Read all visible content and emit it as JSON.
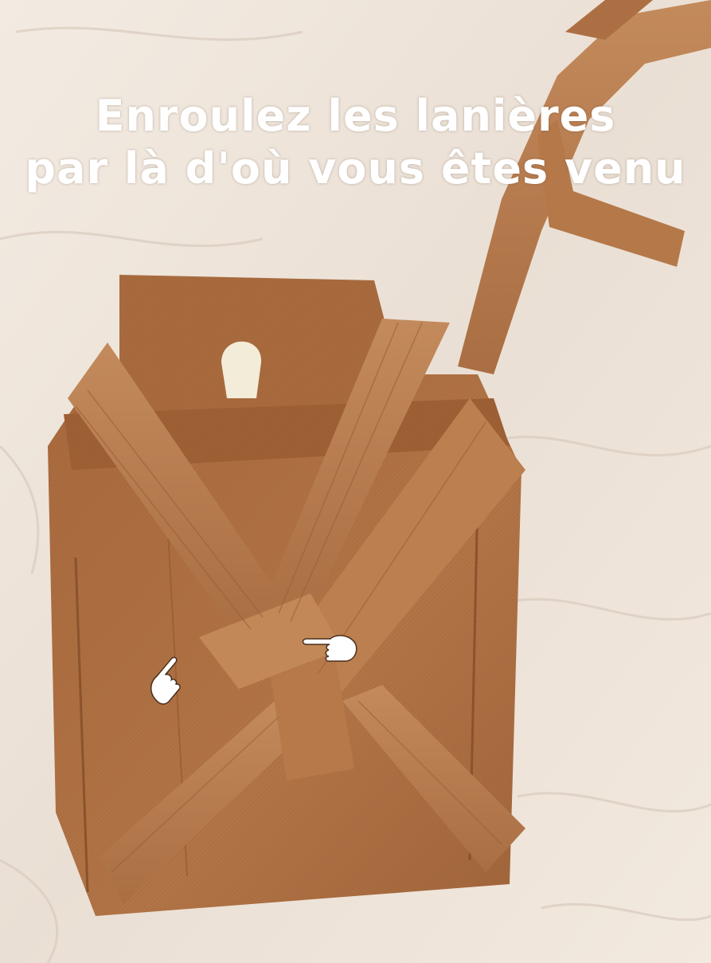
{
  "caption": {
    "line1": "Enroulez les lanières",
    "line2": "par là d'où vous êtes venu"
  },
  "pointers": [
    {
      "name": "pointing-hand-left",
      "direction": "up-right"
    },
    {
      "name": "pointing-hand-right",
      "direction": "right"
    }
  ],
  "colors": {
    "sheet": "#efe6dc",
    "fabric": "#b07345",
    "fabric_dark": "#8c5630",
    "strap": "#b87a4c",
    "strap_light": "#c48a5a",
    "koshiita_tab": "#f3ecd8",
    "caption_text": "#ffffff"
  }
}
